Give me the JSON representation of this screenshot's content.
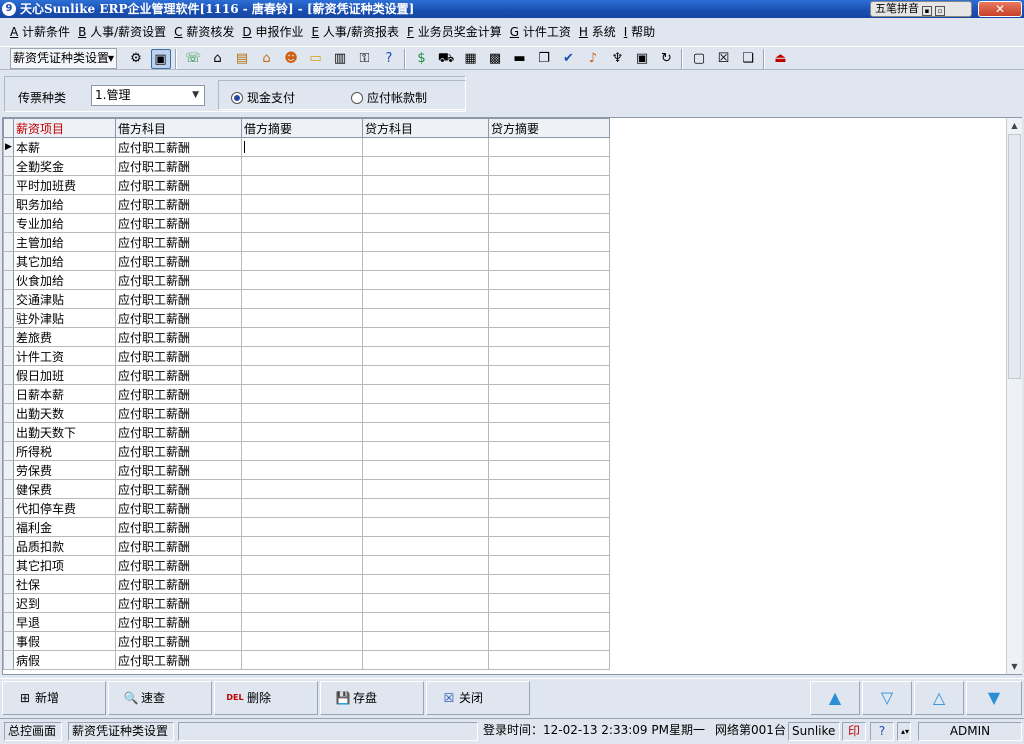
{
  "window": {
    "title": "天心Sunlike ERP企业管理软件[1116 - 唐春铃] - [薪资凭证种类设置]",
    "ime_label": "五笔拼音",
    "app_icon_glyph": "9",
    "close_glyph": "✕"
  },
  "menu": [
    {
      "key": "A",
      "label": "计薪条件"
    },
    {
      "key": "B",
      "label": "人事/薪资设置"
    },
    {
      "key": "C",
      "label": "薪资核发"
    },
    {
      "key": "D",
      "label": "申报作业"
    },
    {
      "key": "E",
      "label": "人事/薪资报表"
    },
    {
      "key": "F",
      "label": "业务员奖金计算"
    },
    {
      "key": "G",
      "label": "计件工资"
    },
    {
      "key": "H",
      "label": "系统"
    },
    {
      "key": "I",
      "label": "帮助"
    }
  ],
  "toolbar": {
    "combo_value": "薪资凭证种类设置",
    "icons": [
      "tree-icon",
      "monitor-icon",
      "phone-icon",
      "home-money-icon",
      "briefcase-icon",
      "house-icon",
      "people-icon",
      "folder-icon",
      "book-icon",
      "key-icon",
      "help-icon",
      "dollar-icon",
      "cart-icon",
      "chart-icon",
      "calculator-icon",
      "drawer-icon",
      "copy-icon",
      "check-icon",
      "bell-icon",
      "org-icon",
      "screen-icon",
      "refresh-icon",
      "window-icon",
      "close-window-icon",
      "cascade-icon",
      "exit-icon"
    ]
  },
  "filter": {
    "type_label": "传票种类",
    "type_value": "1.管理",
    "options": [
      {
        "label": "现金支付",
        "selected": true
      },
      {
        "label": "应付帐款制",
        "selected": false
      }
    ]
  },
  "grid": {
    "columns": [
      "薪资项目",
      "借方科目",
      "借方摘要",
      "贷方科目",
      "贷方摘要"
    ],
    "rows": [
      [
        "本薪",
        "应付职工薪酬",
        "",
        "",
        ""
      ],
      [
        "全勤奖金",
        "应付职工薪酬",
        "",
        "",
        ""
      ],
      [
        "平时加班费",
        "应付职工薪酬",
        "",
        "",
        ""
      ],
      [
        "职务加给",
        "应付职工薪酬",
        "",
        "",
        ""
      ],
      [
        "专业加给",
        "应付职工薪酬",
        "",
        "",
        ""
      ],
      [
        "主管加给",
        "应付职工薪酬",
        "",
        "",
        ""
      ],
      [
        "其它加给",
        "应付职工薪酬",
        "",
        "",
        ""
      ],
      [
        "伙食加给",
        "应付职工薪酬",
        "",
        "",
        ""
      ],
      [
        "交通津贴",
        "应付职工薪酬",
        "",
        "",
        ""
      ],
      [
        "驻外津贴",
        "应付职工薪酬",
        "",
        "",
        ""
      ],
      [
        "差旅费",
        "应付职工薪酬",
        "",
        "",
        ""
      ],
      [
        "计件工资",
        "应付职工薪酬",
        "",
        "",
        ""
      ],
      [
        "假日加班",
        "应付职工薪酬",
        "",
        "",
        ""
      ],
      [
        "日薪本薪",
        "应付职工薪酬",
        "",
        "",
        ""
      ],
      [
        "出勤天数",
        "应付职工薪酬",
        "",
        "",
        ""
      ],
      [
        "出勤天数下",
        "应付职工薪酬",
        "",
        "",
        ""
      ],
      [
        "所得税",
        "应付职工薪酬",
        "",
        "",
        ""
      ],
      [
        "劳保费",
        "应付职工薪酬",
        "",
        "",
        ""
      ],
      [
        "健保费",
        "应付职工薪酬",
        "",
        "",
        ""
      ],
      [
        "代扣停车费",
        "应付职工薪酬",
        "",
        "",
        ""
      ],
      [
        "福利金",
        "应付职工薪酬",
        "",
        "",
        ""
      ],
      [
        "品质扣款",
        "应付职工薪酬",
        "",
        "",
        ""
      ],
      [
        "其它扣项",
        "应付职工薪酬",
        "",
        "",
        ""
      ],
      [
        "社保",
        "应付职工薪酬",
        "",
        "",
        ""
      ],
      [
        "迟到",
        "应付职工薪酬",
        "",
        "",
        ""
      ],
      [
        "早退",
        "应付职工薪酬",
        "",
        "",
        ""
      ],
      [
        "事假",
        "应付职工薪酬",
        "",
        "",
        ""
      ],
      [
        "病假",
        "应付职工薪酬",
        "",
        "",
        ""
      ]
    ]
  },
  "buttons": {
    "add": "新增",
    "query": "速查",
    "delete": "删除",
    "save": "存盘",
    "close": "关闭",
    "delete_icon_text": "DEL"
  },
  "status": {
    "tab1": "总控画面",
    "tab2": "薪资凭证种类设置",
    "login_time": "登录时间：12-02-13 2:33:09 PM",
    "weekday": "星期一",
    "network": "网络第001台",
    "product": "Sunlike E",
    "user": "ADMIN"
  },
  "colors": {
    "title_blue": "#1a4eb0",
    "selected_header": "#c00000",
    "nav_arrow": "#2a8fd6"
  }
}
